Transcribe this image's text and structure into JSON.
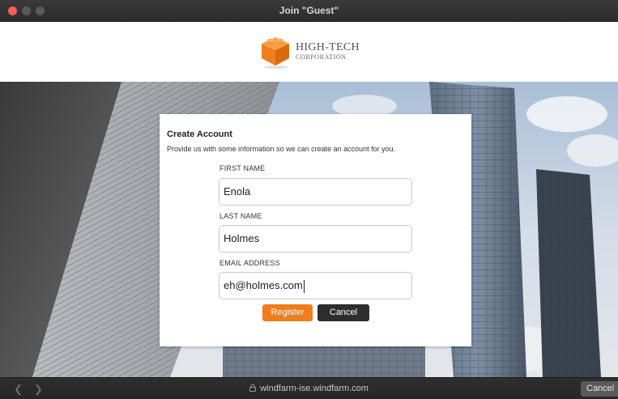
{
  "window": {
    "title": "Join \"Guest\""
  },
  "header": {
    "logo_line1": "HIGH-TECH",
    "logo_line2": "CORPORATION"
  },
  "card": {
    "title": "Create Account",
    "subtitle": "Provide us with some information so we can create an account for you.",
    "fields": [
      {
        "label": "FIRST NAME",
        "value": "Enola"
      },
      {
        "label": "LAST NAME",
        "value": "Holmes"
      },
      {
        "label": "EMAIL ADDRESS",
        "value": "eh@holmes.com"
      }
    ],
    "register_label": "Register",
    "cancel_label": "Cancel"
  },
  "bottombar": {
    "back_icon": "chevron-left-icon",
    "forward_icon": "chevron-right-icon",
    "url": "windfarm-ise.windfarm.com",
    "cancel_label": "Cancel"
  },
  "colors": {
    "accent": "#f07d1a",
    "cancel_button": "#2d2d2d",
    "close_dot": "#ff5f57"
  }
}
